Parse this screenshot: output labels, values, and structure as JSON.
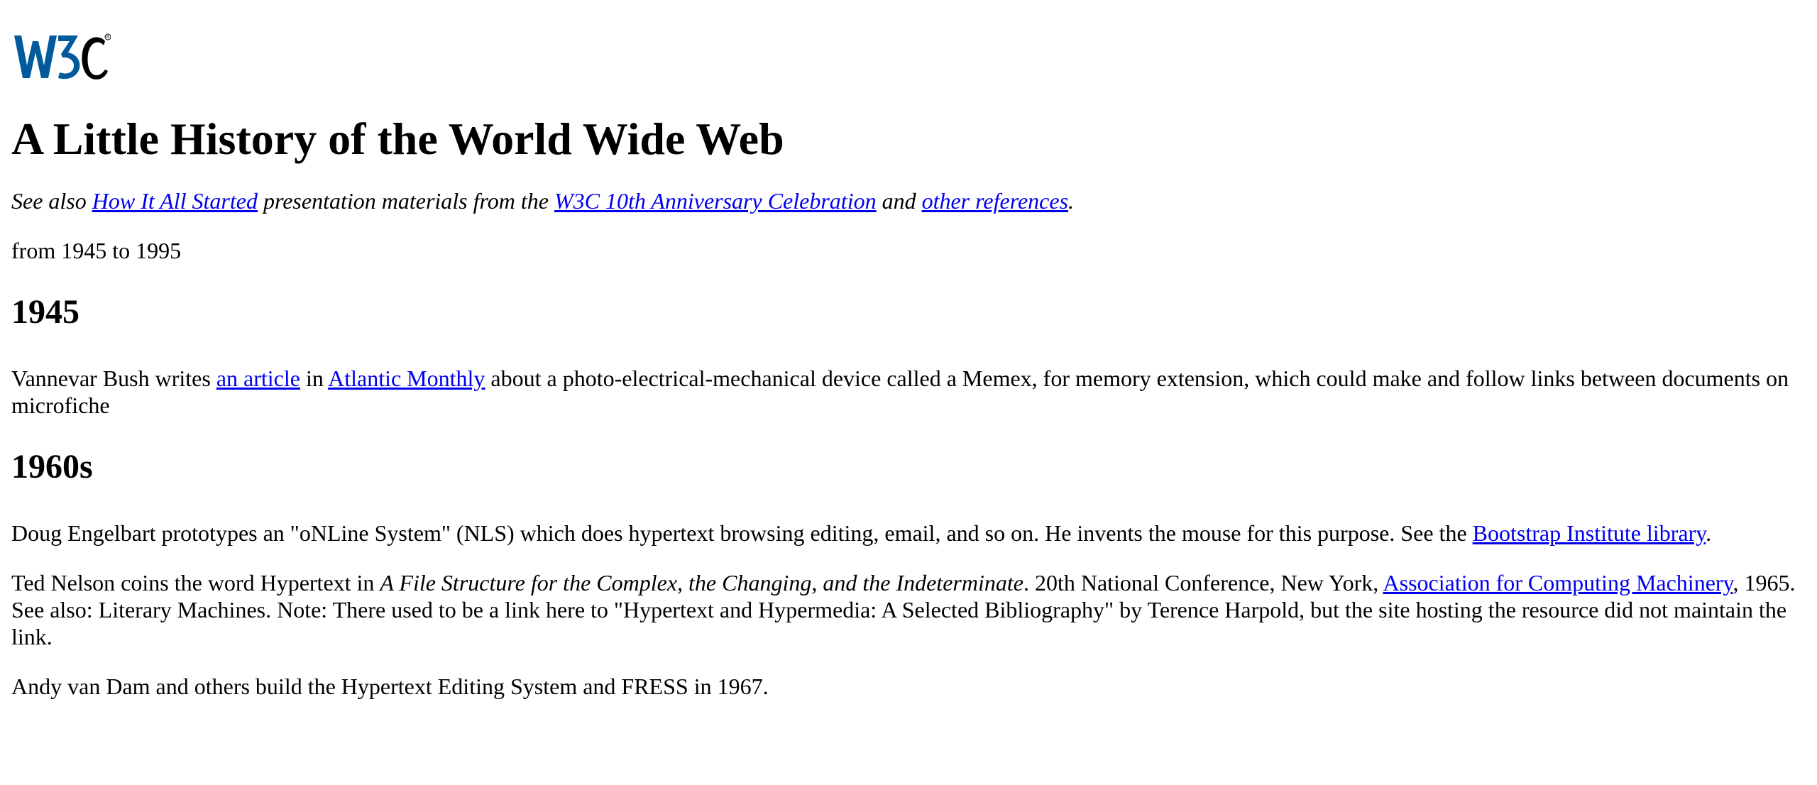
{
  "logo": {
    "text": "W3C",
    "registered_mark": "®",
    "color": "#005a9c"
  },
  "title": "A Little History of the World Wide Web",
  "see_also": {
    "prefix": "See also ",
    "link1": "How It All Started",
    "middle": " presentation materials from the ",
    "link2": "W3C 10th Anniversary Celebration",
    "and": " and ",
    "link3": "other references",
    "suffix": "."
  },
  "span": "from 1945 to 1995",
  "sections": [
    {
      "heading": "1945",
      "paragraphs": [
        {
          "t1": "Vannevar Bush writes ",
          "link1": "an article",
          "t2": " in ",
          "link2": "Atlantic Monthly",
          "t3": " about a photo-electrical-mechanical device called a Memex, for memory extension, which could make and follow links between documents on microfiche"
        }
      ]
    },
    {
      "heading": "1960s",
      "paragraphs": [
        {
          "t1": "Doug Engelbart prototypes an \"oNLine System\" (NLS) which does hypertext browsing editing, email, and so on. He invents the mouse for this purpose. See the ",
          "link1": "Bootstrap Institute library",
          "t2": "."
        },
        {
          "t1": "Ted Nelson coins the word Hypertext in ",
          "em": "A File Structure for the Complex, the Changing, and the Indeterminate",
          "t2": ". 20th National Conference, New York, ",
          "link1": "Association for Computing Machinery",
          "t3": ", 1965. See also: Literary Machines. Note: There used to be a link here to \"Hypertext and Hypermedia: A Selected Bibliography\" by Terence Harpold, but the site hosting the resource did not maintain the link."
        },
        {
          "t1": "Andy van Dam and others build the Hypertext Editing System and FRESS in 1967."
        }
      ]
    }
  ]
}
